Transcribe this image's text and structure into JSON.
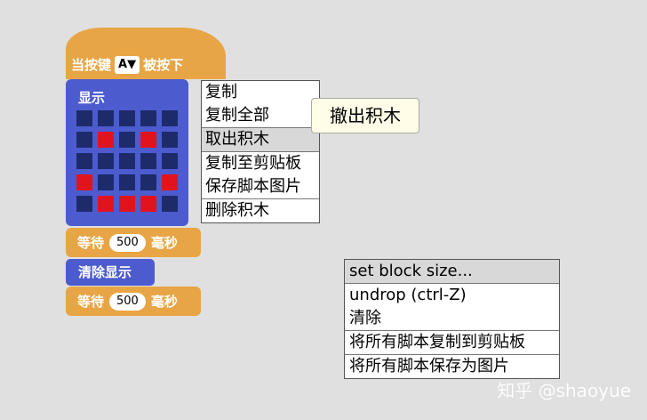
{
  "hat_block": {
    "prefix": "当按键",
    "key": "A▼",
    "suffix": "被按下"
  },
  "display_block": {
    "label": "显示",
    "led_grid": [
      [
        0,
        0,
        0,
        0,
        0
      ],
      [
        0,
        1,
        0,
        1,
        0
      ],
      [
        0,
        0,
        0,
        0,
        0
      ],
      [
        1,
        0,
        0,
        0,
        1
      ],
      [
        0,
        1,
        1,
        1,
        0
      ]
    ]
  },
  "wait_block_1": {
    "prefix": "等待",
    "value": "500",
    "suffix": "毫秒"
  },
  "clear_block": {
    "label": "清除显示"
  },
  "wait_block_2": {
    "prefix": "等待",
    "value": "500",
    "suffix": "毫秒"
  },
  "block_menu": {
    "items": [
      {
        "label": "复制"
      },
      {
        "label": "复制全部"
      },
      {
        "label": "取出积木"
      },
      {
        "label": "复制至剪贴板"
      },
      {
        "label": "保存脚本图片"
      },
      {
        "label": "删除积木"
      }
    ]
  },
  "tooltip": {
    "text": "撤出积木"
  },
  "canvas_menu": {
    "items": [
      {
        "label": "set block size..."
      },
      {
        "label": "undrop  (ctrl-Z)"
      },
      {
        "label": "清除"
      },
      {
        "label": "将所有脚本复制到剪贴板"
      },
      {
        "label": "将所有脚本保存为图片"
      }
    ]
  },
  "watermark": {
    "text": "知乎 @shaoyue"
  },
  "colors": {
    "event_orange": "#e8a545",
    "looks_blue": "#4c5ccf",
    "led_on": "#e1141d",
    "led_off": "#1d2b6b",
    "canvas_bg": "#e0e0e0"
  }
}
